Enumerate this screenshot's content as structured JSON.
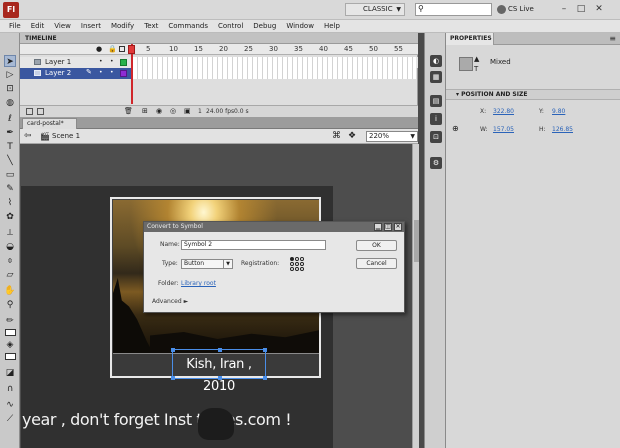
{
  "app": {
    "logo_text": "Fl",
    "workspace": "CLASSIC",
    "cs_live": "CS Live"
  },
  "menu": [
    "File",
    "Edit",
    "View",
    "Insert",
    "Modify",
    "Text",
    "Commands",
    "Control",
    "Debug",
    "Window",
    "Help"
  ],
  "timeline": {
    "tab_label": "TIMELINE",
    "frame_numbers": [
      "1",
      "5",
      "10",
      "15",
      "20",
      "25",
      "30",
      "35",
      "40",
      "45",
      "50",
      "55"
    ],
    "layers": [
      {
        "name": "Layer 1"
      },
      {
        "name": "Layer 2"
      }
    ],
    "footer": {
      "current_frame": "1",
      "fps": "24.00 fps",
      "time": "0.0 s"
    }
  },
  "document": {
    "tab": "card-postal*",
    "scene": "Scene 1",
    "zoom": "220%"
  },
  "stage": {
    "caption": "Kish, Iran , 2010",
    "bottom_text": "year , don't forget Inst    tables.com !"
  },
  "dialog": {
    "title": "Convert to Symbol",
    "name_label": "Name:",
    "name_value": "Symbol 2",
    "type_label": "Type:",
    "type_value": "Button",
    "registration_label": "Registration:",
    "folder_label": "Folder:",
    "folder_value": "Library root",
    "advanced_label": "Advanced",
    "ok_label": "OK",
    "cancel_label": "Cancel"
  },
  "properties": {
    "tab_label": "PROPERTIES",
    "instance_label": "Mixed",
    "section_title": "POSITION AND SIZE",
    "x_label": "X:",
    "x_value": "322.80",
    "y_label": "Y:",
    "y_value": "9.80",
    "w_label": "W:",
    "w_value": "157.05",
    "h_label": "H:",
    "h_value": "126.85"
  },
  "colors": {
    "selection_blue": "#3a57a0",
    "playhead": "#d0262b",
    "link_blue": "#2a63b9"
  }
}
